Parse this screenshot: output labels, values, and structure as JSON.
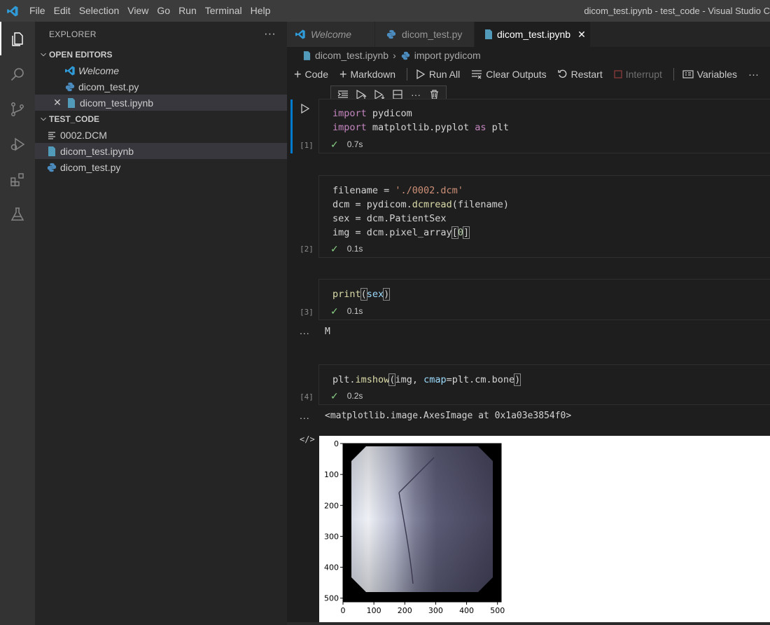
{
  "titlebar": {
    "menu": [
      "File",
      "Edit",
      "Selection",
      "View",
      "Go",
      "Run",
      "Terminal",
      "Help"
    ],
    "window_title": "dicom_test.ipynb - test_code - Visual Studio C"
  },
  "activitybar": [
    "explorer-icon",
    "search-icon",
    "source-control-icon",
    "run-debug-icon",
    "extensions-icon",
    "testing-icon"
  ],
  "sidebar": {
    "title": "EXPLORER",
    "more": "···",
    "open_editors": {
      "header": "OPEN EDITORS",
      "items": [
        {
          "label": "Welcome",
          "icon": "vscode-icon"
        },
        {
          "label": "dicom_test.py",
          "icon": "python-icon"
        },
        {
          "label": "dicom_test.ipynb",
          "icon": "notebook-icon"
        }
      ]
    },
    "folder": {
      "header": "TEST_CODE",
      "items": [
        {
          "label": "0002.DCM",
          "icon": "file-lines-icon"
        },
        {
          "label": "dicom_test.ipynb",
          "icon": "notebook-icon"
        },
        {
          "label": "dicom_test.py",
          "icon": "python-icon"
        }
      ]
    }
  },
  "tabs": [
    {
      "label": "Welcome",
      "icon": "vscode-icon"
    },
    {
      "label": "dicom_test.py",
      "icon": "python-icon"
    },
    {
      "label": "dicom_test.ipynb",
      "icon": "notebook-icon",
      "close": "✕"
    }
  ],
  "breadcrumb": {
    "file": "dicom_test.ipynb",
    "symbol": "import pydicom"
  },
  "toolbar": {
    "code": "Code",
    "markdown": "Markdown",
    "run_all": "Run All",
    "clear_outputs": "Clear Outputs",
    "restart": "Restart",
    "interrupt": "Interrupt",
    "variables": "Variables",
    "more": "···"
  },
  "cells": [
    {
      "exec": "[1]",
      "time": "0.7s"
    },
    {
      "exec": "[2]",
      "time": "0.1s"
    },
    {
      "exec": "[3]",
      "time": "0.1s"
    },
    {
      "exec": "[4]",
      "time": "0.2s"
    }
  ],
  "code": {
    "c1": {
      "l1_kw": "import",
      "l1_rest": " pydicom",
      "l2_kw": "import",
      "l2_mod": " matplotlib.pyplot ",
      "l2_as": "as",
      "l2_rest": " plt"
    },
    "c2": {
      "l1_a": "filename = ",
      "l1_str": "'./0002.dcm'",
      "l2_a": "dcm = pydicom.",
      "l2_fn": "dcmread",
      "l2_b": "(filename)",
      "l3": "sex = dcm.PatientSex",
      "l4_a": "img = dcm.pixel_array",
      "l4_b": "[",
      "l4_num": "0",
      "l4_c": "]"
    },
    "c3": {
      "fn": "print",
      "open": "(",
      "arg": "sex",
      "close": ")"
    },
    "c4": {
      "a": "plt.",
      "fn": "imshow",
      "open": "(",
      "b": "img, ",
      "param": "cmap",
      "c": "=plt.cm.bone",
      "close": ")"
    }
  },
  "outputs": {
    "dots": "...",
    "out3": "M",
    "out4": "<matplotlib.image.AxesImage at 0x1a03e3854f0>",
    "code_icon": "</>"
  },
  "chart_data": {
    "type": "heatmap",
    "title": "",
    "xlabel": "",
    "ylabel": "",
    "x_ticks": [
      "0",
      "100",
      "200",
      "300",
      "400",
      "500"
    ],
    "y_ticks": [
      "0",
      "100",
      "200",
      "300",
      "400",
      "500"
    ],
    "xlim": [
      0,
      512
    ],
    "ylim": [
      512,
      0
    ],
    "colormap": "bone"
  }
}
